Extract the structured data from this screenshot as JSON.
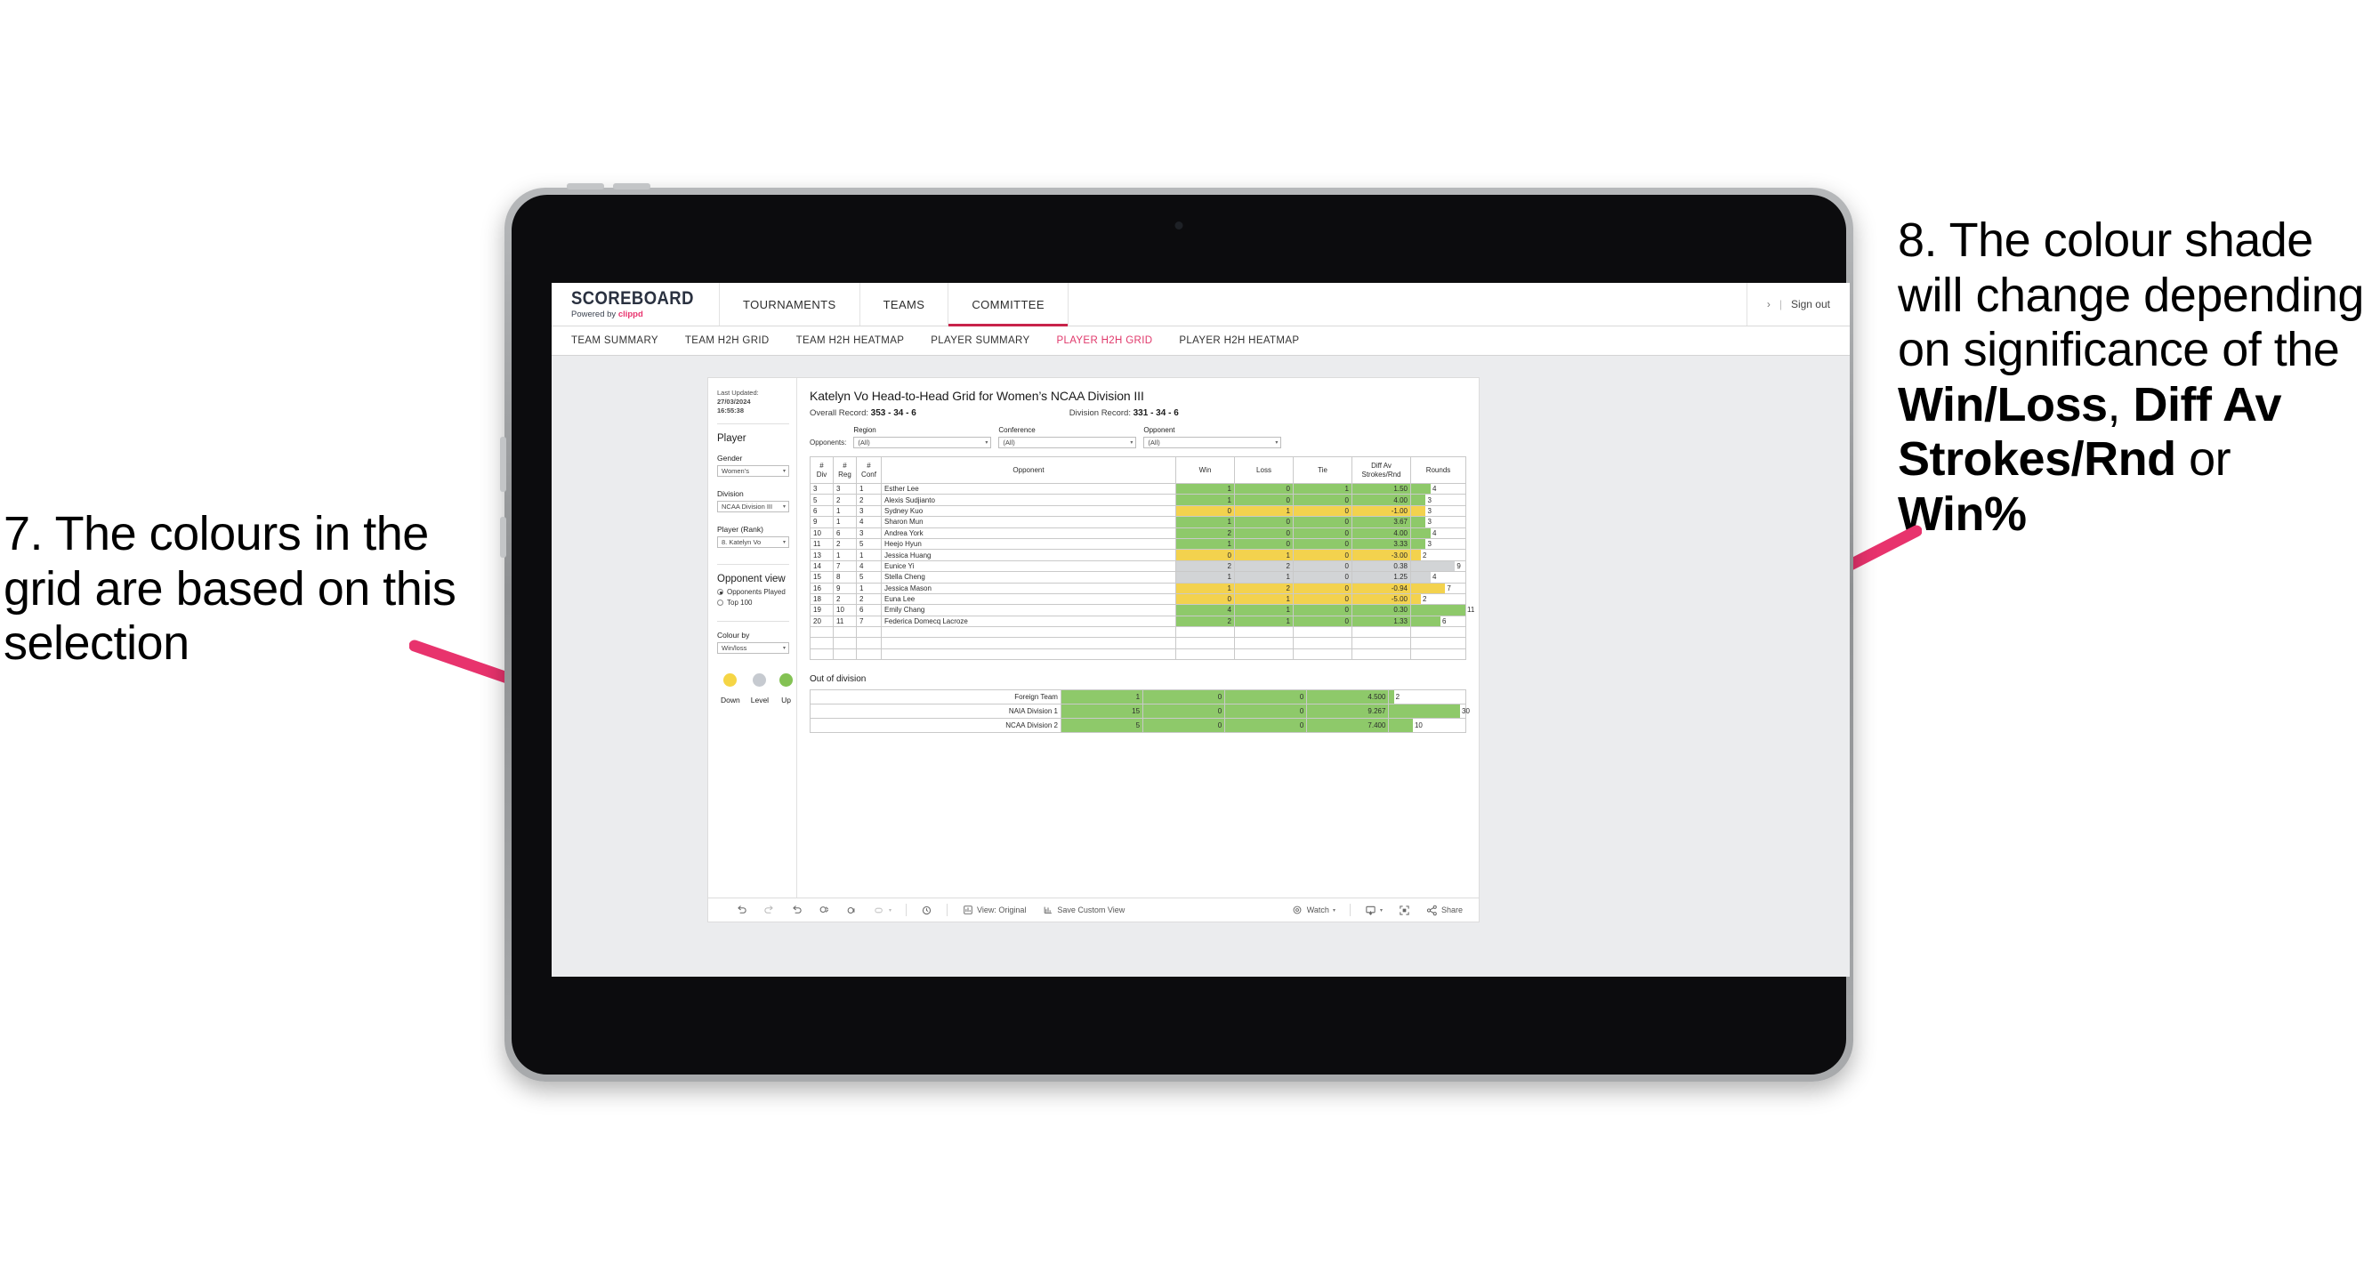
{
  "annotations": {
    "left": {
      "id": "7.",
      "text": "7. The colours in the grid are based on this selection"
    },
    "right": {
      "id": "8.",
      "line1": "8. The colour shade will change depending on significance of the ",
      "bold1": "Win/Loss",
      "mid1": ", ",
      "bold2": "Diff Av Strokes/Rnd",
      "mid2": " or ",
      "bold3": "Win%"
    },
    "arrow_color": "#e8336d"
  },
  "topnav": {
    "brand_name": "SCOREBOARD",
    "brand_sub_prefix": "Powered by ",
    "brand_sub_name": "clippd",
    "items": [
      {
        "label": "TOURNAMENTS",
        "active": false
      },
      {
        "label": "TEAMS",
        "active": false
      },
      {
        "label": "COMMITTEE",
        "active": true
      }
    ],
    "chevron": "›",
    "divider": "|",
    "sign_out": "Sign out"
  },
  "subnav": {
    "items": [
      {
        "label": "TEAM SUMMARY",
        "active": false
      },
      {
        "label": "TEAM H2H GRID",
        "active": false
      },
      {
        "label": "TEAM H2H HEATMAP",
        "active": false
      },
      {
        "label": "PLAYER SUMMARY",
        "active": false
      },
      {
        "label": "PLAYER H2H GRID",
        "active": true
      },
      {
        "label": "PLAYER H2H HEATMAP",
        "active": false
      }
    ]
  },
  "sidebar": {
    "last_updated_label": "Last Updated: ",
    "last_updated_date": "27/03/2024",
    "last_updated_time": "16:55:38",
    "player_heading": "Player",
    "gender_label": "Gender",
    "gender_value": "Women’s",
    "division_label": "Division",
    "division_value": "NCAA Division III",
    "player_rank_label": "Player (Rank)",
    "player_rank_value": "8. Katelyn Vo",
    "opponent_view_heading": "Opponent view",
    "opponent_view_options": [
      {
        "label": "Opponents Played",
        "selected": true
      },
      {
        "label": "Top 100",
        "selected": false
      }
    ],
    "colour_by_label": "Colour by",
    "colour_by_value": "Win/loss",
    "legend": [
      {
        "label": "Down",
        "color": "#f5d545"
      },
      {
        "label": "Level",
        "color": "#c6cad0"
      },
      {
        "label": "Up",
        "color": "#84c254"
      }
    ],
    "caret": "▾"
  },
  "main": {
    "title": "Katelyn Vo Head-to-Head Grid for Women’s NCAA Division III",
    "overall_record_label": "Overall Record: ",
    "overall_record_value": "353 - 34 - 6",
    "division_record_label": "Division Record: ",
    "division_record_value": "331 - 34 - 6",
    "opponents_label": "Opponents:",
    "filters": [
      {
        "label": "Region",
        "value": "(All)"
      },
      {
        "label": "Conference",
        "value": "(All)"
      },
      {
        "label": "Opponent",
        "value": "(All)"
      }
    ]
  },
  "chart_data": {
    "type": "table",
    "title": "Katelyn Vo Head-to-Head Grid for Women’s NCAA Division III",
    "columns": [
      {
        "key": "div",
        "line1": "#",
        "line2": "Div"
      },
      {
        "key": "reg",
        "line1": "#",
        "line2": "Reg"
      },
      {
        "key": "conf",
        "line1": "#",
        "line2": "Conf"
      },
      {
        "key": "opponent",
        "line1": "Opponent",
        "line2": ""
      },
      {
        "key": "win",
        "line1": "Win",
        "line2": ""
      },
      {
        "key": "loss",
        "line1": "Loss",
        "line2": ""
      },
      {
        "key": "tie",
        "line1": "Tie",
        "line2": ""
      },
      {
        "key": "diff",
        "line1": "Diff Av",
        "line2": "Strokes/Rnd"
      },
      {
        "key": "rounds",
        "line1": "Rounds",
        "line2": ""
      }
    ],
    "colors": {
      "up": "#8ec96a",
      "down": "#f3d24e",
      "level": "#d2d4d6",
      "none": "#ffffff"
    },
    "rows": [
      {
        "div": "3",
        "reg": "3",
        "conf": "1",
        "opponent": "Esther Lee",
        "win": "1",
        "loss": "0",
        "tie": "1",
        "diff": "1.50",
        "rounds": "4",
        "rounds_pct": 36,
        "shade": "up"
      },
      {
        "div": "5",
        "reg": "2",
        "conf": "2",
        "opponent": "Alexis Sudjianto",
        "win": "1",
        "loss": "0",
        "tie": "0",
        "diff": "4.00",
        "rounds": "3",
        "rounds_pct": 27,
        "shade": "up"
      },
      {
        "div": "6",
        "reg": "1",
        "conf": "3",
        "opponent": "Sydney Kuo",
        "win": "0",
        "loss": "1",
        "tie": "0",
        "diff": "-1.00",
        "rounds": "3",
        "rounds_pct": 27,
        "shade": "down"
      },
      {
        "div": "9",
        "reg": "1",
        "conf": "4",
        "opponent": "Sharon Mun",
        "win": "1",
        "loss": "0",
        "tie": "0",
        "diff": "3.67",
        "rounds": "3",
        "rounds_pct": 27,
        "shade": "up"
      },
      {
        "div": "10",
        "reg": "6",
        "conf": "3",
        "opponent": "Andrea York",
        "win": "2",
        "loss": "0",
        "tie": "0",
        "diff": "4.00",
        "rounds": "4",
        "rounds_pct": 36,
        "shade": "up"
      },
      {
        "div": "11",
        "reg": "2",
        "conf": "5",
        "opponent": "Heejo Hyun",
        "win": "1",
        "loss": "0",
        "tie": "0",
        "diff": "3.33",
        "rounds": "3",
        "rounds_pct": 27,
        "shade": "up"
      },
      {
        "div": "13",
        "reg": "1",
        "conf": "1",
        "opponent": "Jessica Huang",
        "win": "0",
        "loss": "1",
        "tie": "0",
        "diff": "-3.00",
        "rounds": "2",
        "rounds_pct": 18,
        "shade": "down"
      },
      {
        "div": "14",
        "reg": "7",
        "conf": "4",
        "opponent": "Eunice Yi",
        "win": "2",
        "loss": "2",
        "tie": "0",
        "diff": "0.38",
        "rounds": "9",
        "rounds_pct": 81,
        "shade": "level"
      },
      {
        "div": "15",
        "reg": "8",
        "conf": "5",
        "opponent": "Stella Cheng",
        "win": "1",
        "loss": "1",
        "tie": "0",
        "diff": "1.25",
        "rounds": "4",
        "rounds_pct": 36,
        "shade": "level"
      },
      {
        "div": "16",
        "reg": "9",
        "conf": "1",
        "opponent": "Jessica Mason",
        "win": "1",
        "loss": "2",
        "tie": "0",
        "diff": "-0.94",
        "rounds": "7",
        "rounds_pct": 63,
        "shade": "down"
      },
      {
        "div": "18",
        "reg": "2",
        "conf": "2",
        "opponent": "Euna Lee",
        "win": "0",
        "loss": "1",
        "tie": "0",
        "diff": "-5.00",
        "rounds": "2",
        "rounds_pct": 18,
        "shade": "down"
      },
      {
        "div": "19",
        "reg": "10",
        "conf": "6",
        "opponent": "Emily Chang",
        "win": "4",
        "loss": "1",
        "tie": "0",
        "diff": "0.30",
        "rounds": "11",
        "rounds_pct": 100,
        "shade": "up"
      },
      {
        "div": "20",
        "reg": "11",
        "conf": "7",
        "opponent": "Federica Domecq Lacroze",
        "win": "2",
        "loss": "1",
        "tie": "0",
        "diff": "1.33",
        "rounds": "6",
        "rounds_pct": 54,
        "shade": "up"
      }
    ],
    "out_of_division": {
      "title": "Out of division",
      "rows": [
        {
          "name": "Foreign Team",
          "win": "1",
          "loss": "0",
          "tie": "0",
          "diff": "4.500",
          "rounds": "2",
          "rounds_pct": 6,
          "shade": "up"
        },
        {
          "name": "NAIA Division 1",
          "win": "15",
          "loss": "0",
          "tie": "0",
          "diff": "9.267",
          "rounds": "30",
          "rounds_pct": 93,
          "shade": "up"
        },
        {
          "name": "NCAA Division 2",
          "win": "5",
          "loss": "0",
          "tie": "0",
          "diff": "7.400",
          "rounds": "10",
          "rounds_pct": 31,
          "shade": "up"
        }
      ]
    }
  },
  "toolbar": {
    "undo": "undo-icon",
    "redo": "redo-icon",
    "revert": "revert-icon",
    "refresh": "refresh-icon",
    "pause": "pause-icon",
    "highlight": "highlight-icon",
    "alerts": "alerts-icon",
    "view_label": "View: Original",
    "save_custom_view": "Save Custom View",
    "watch": "Watch",
    "download": "download-icon",
    "fullscreen": "fullscreen-icon",
    "share": "Share",
    "caret": "▾"
  }
}
